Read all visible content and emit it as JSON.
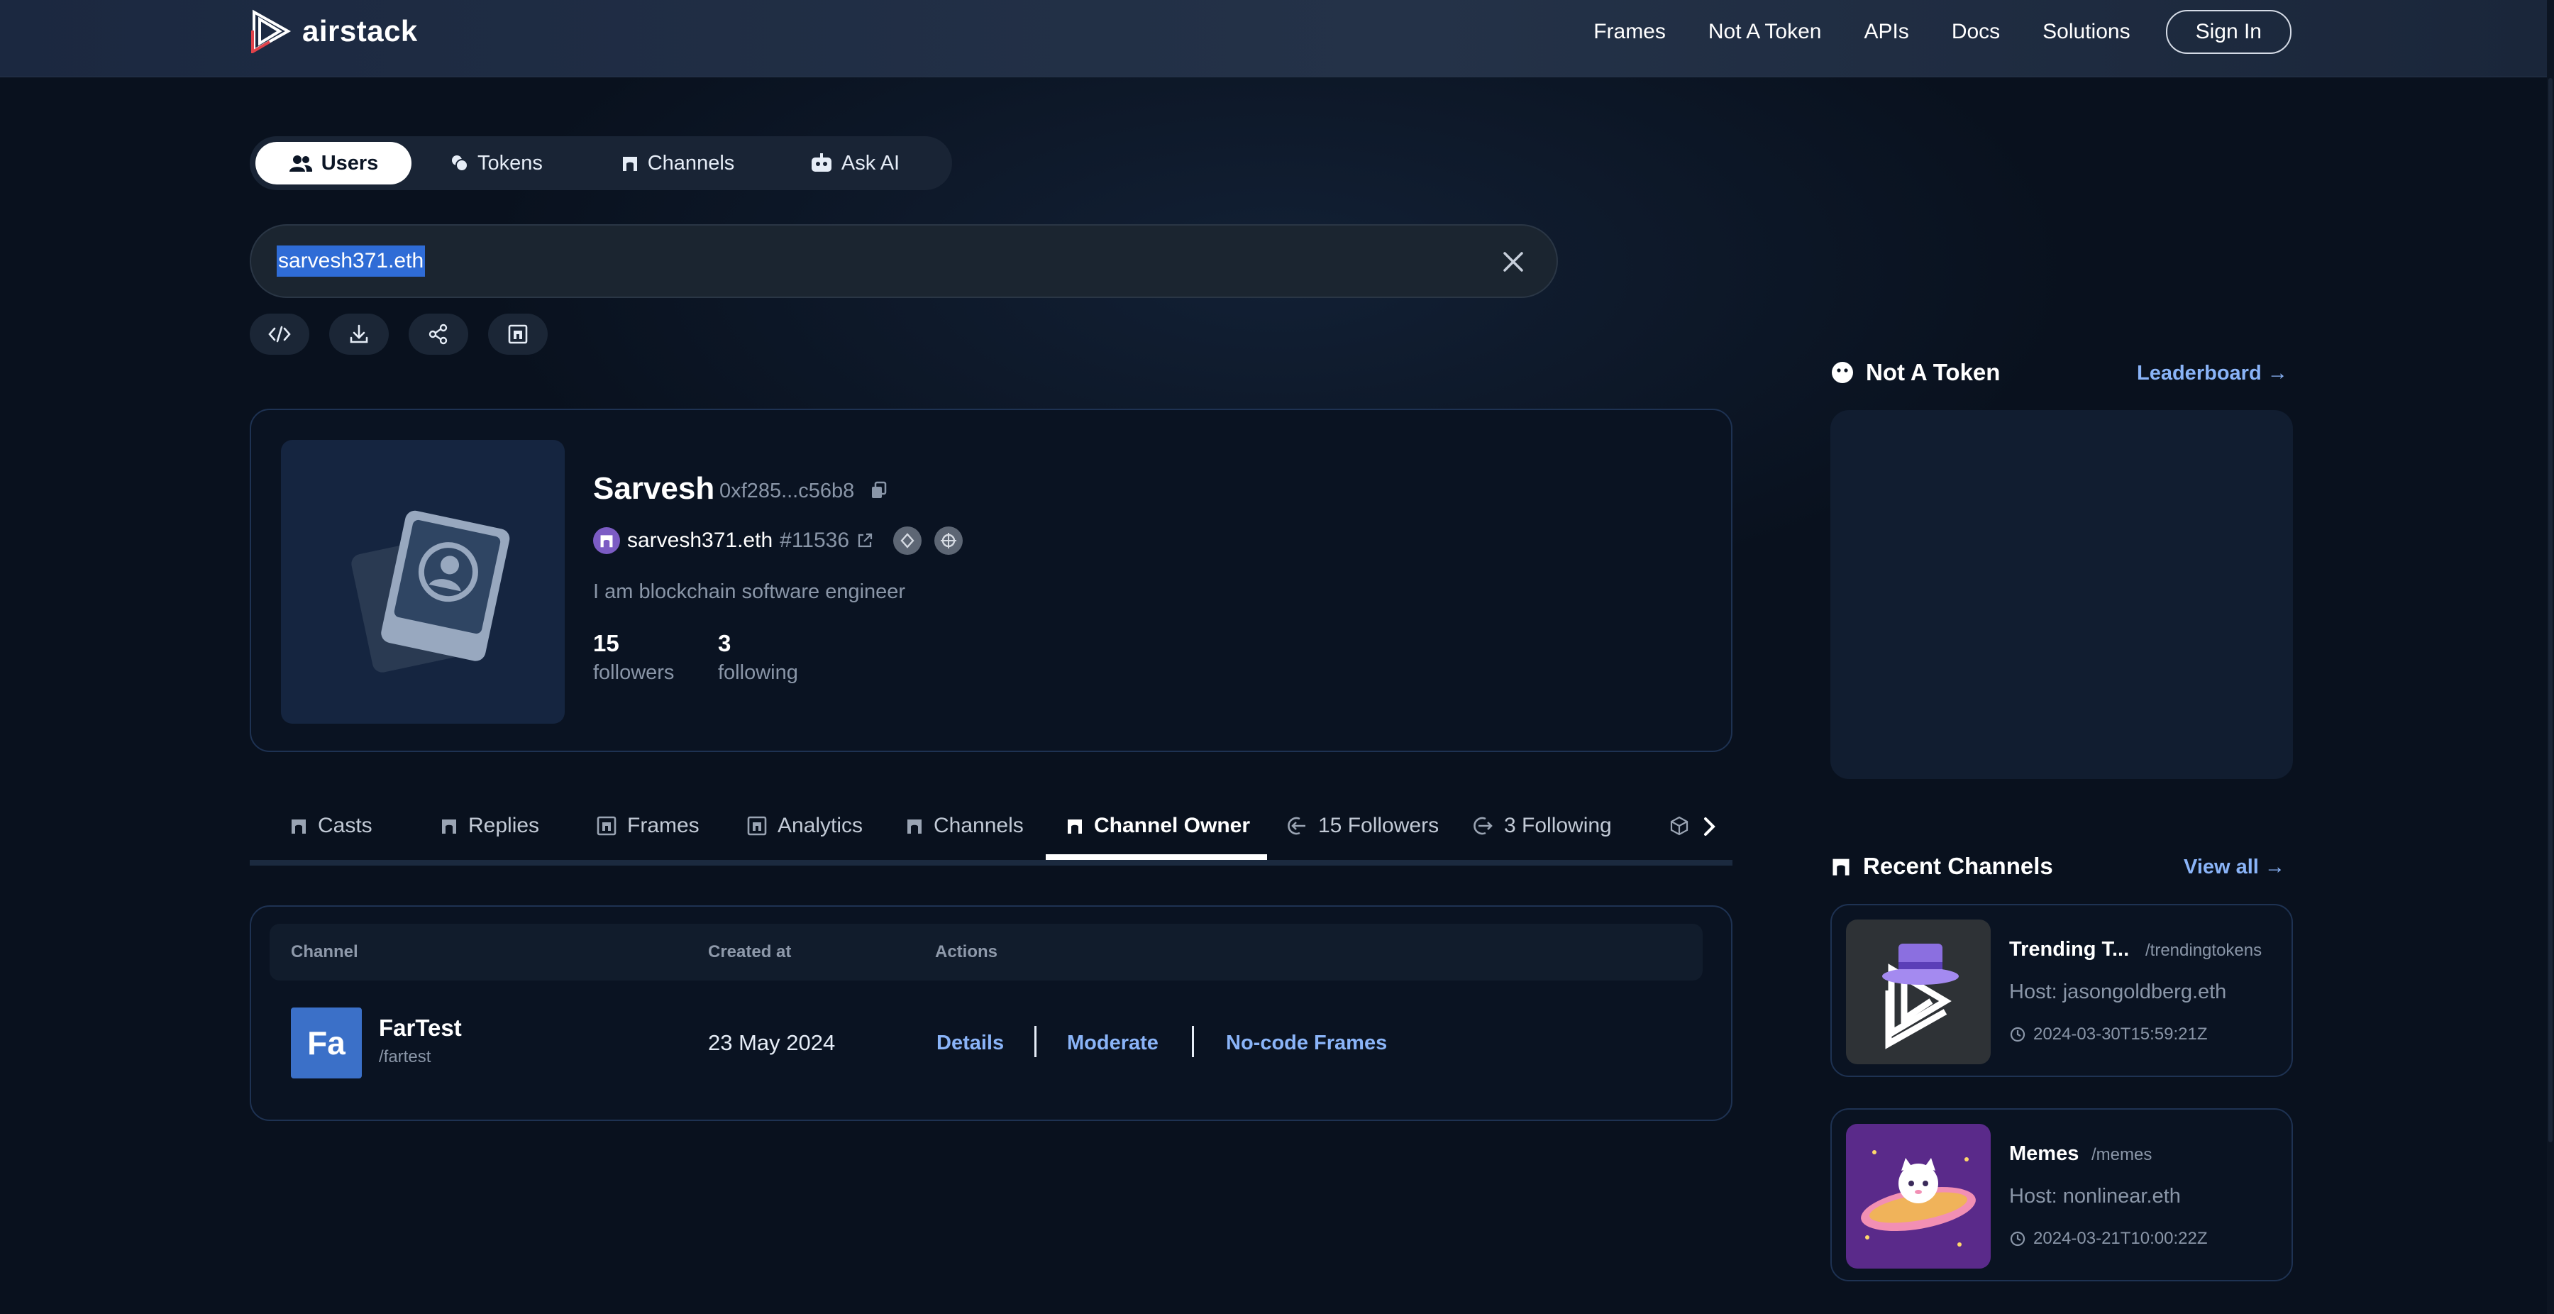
{
  "nav": {
    "brand": "airstack",
    "links": [
      "Frames",
      "Not A Token",
      "APIs",
      "Docs",
      "Solutions"
    ],
    "signin": "Sign In"
  },
  "search_tabs": [
    {
      "label": "Users",
      "icon": "users-icon",
      "active": true
    },
    {
      "label": "Tokens",
      "icon": "coins-icon",
      "active": false
    },
    {
      "label": "Channels",
      "icon": "farcaster-icon",
      "active": false
    },
    {
      "label": "Ask AI",
      "icon": "robot-icon",
      "active": false
    }
  ],
  "search": {
    "value": "sarvesh371.eth"
  },
  "tool_icons": [
    "code-icon",
    "download-icon",
    "share-icon",
    "frame-icon"
  ],
  "profile": {
    "name": "Sarvesh",
    "address": "0xf285...c56b8",
    "farcaster_handle": "sarvesh371.eth",
    "fid": "#11536",
    "bio": "I am blockchain software engineer",
    "followers_count": "15",
    "followers_label": "followers",
    "following_count": "3",
    "following_label": "following"
  },
  "section_tabs": [
    {
      "label": "Casts",
      "icon": "farcaster-icon"
    },
    {
      "label": "Replies",
      "icon": "farcaster-icon"
    },
    {
      "label": "Frames",
      "icon": "frame-icon"
    },
    {
      "label": "Analytics",
      "icon": "frame-icon"
    },
    {
      "label": "Channels",
      "icon": "farcaster-icon"
    },
    {
      "label": "Channel Owner",
      "icon": "farcaster-icon",
      "active": true
    },
    {
      "label": "15 Followers",
      "icon": "arrow-in-icon"
    },
    {
      "label": "3 Following",
      "icon": "arrow-out-icon"
    }
  ],
  "channel_table": {
    "headers": [
      "Channel",
      "Created at",
      "Actions"
    ],
    "rows": [
      {
        "icon_text": "Fa",
        "name": "FarTest",
        "slug": "/fartest",
        "created": "23 May 2024",
        "actions": [
          "Details",
          "Moderate",
          "No-code Frames"
        ]
      }
    ]
  },
  "sidebar": {
    "not_a_token": {
      "title": "Not A Token",
      "link": "Leaderboard →"
    },
    "recent_channels": {
      "title": "Recent Channels",
      "link": "View all →",
      "items": [
        {
          "name": "Trending T...",
          "slug": "/trendingtokens",
          "host": "Host: jasongoldberg.eth",
          "time": "2024-03-30T15:59:21Z"
        },
        {
          "name": "Memes",
          "slug": "/memes",
          "host": "Host: nonlinear.eth",
          "time": "2024-03-21T10:00:22Z"
        }
      ]
    }
  },
  "colors": {
    "accent_link": "#8ab4f8",
    "fartest_badge": "#3b70c8",
    "active_tab_bg": "#ffffff"
  }
}
